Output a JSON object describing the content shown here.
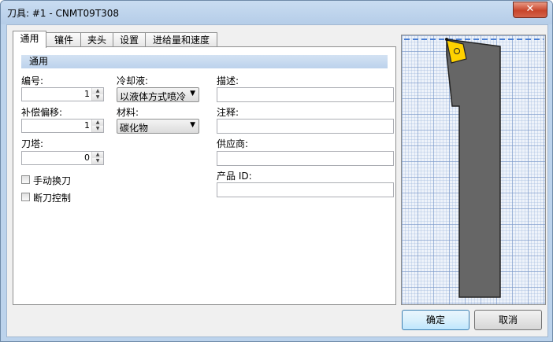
{
  "window": {
    "title": "刀具: #1 - CNMT09T308",
    "close_glyph": "✕"
  },
  "tabs": [
    {
      "label": "通用",
      "active": true
    },
    {
      "label": "镶件",
      "active": false
    },
    {
      "label": "夹头",
      "active": false
    },
    {
      "label": "设置",
      "active": false
    },
    {
      "label": "进给量和速度",
      "active": false
    }
  ],
  "section": {
    "title": "通用"
  },
  "fields": {
    "number": {
      "label": "编号:",
      "value": "1"
    },
    "offset": {
      "label": "补偿偏移:",
      "value": "1"
    },
    "turret": {
      "label": "刀塔:",
      "value": "0"
    },
    "coolant": {
      "label": "冷却液:",
      "value": "以液体方式喷冷"
    },
    "material": {
      "label": "材料:",
      "value": "碳化物"
    },
    "description": {
      "label": "描述:",
      "value": ""
    },
    "comment": {
      "label": "注释:",
      "value": ""
    },
    "supplier": {
      "label": "供应商:",
      "value": ""
    },
    "product_id": {
      "label": "产品 ID:",
      "value": ""
    }
  },
  "checkboxes": [
    {
      "label": "手动换刀",
      "checked": false
    },
    {
      "label": "断刀控制",
      "checked": false
    }
  ],
  "buttons": {
    "ok": "确定",
    "cancel": "取消"
  },
  "colors": {
    "titlebar": "#b5cde8",
    "section_header": "#c6d9ef",
    "insert": "#ffd200",
    "tool_body": "#666666",
    "close_button": "#c8452b",
    "dashed_line": "#4a7fd4"
  },
  "icons": {
    "spin_up": "▲",
    "spin_down": "▼",
    "dropdown": "▼"
  }
}
